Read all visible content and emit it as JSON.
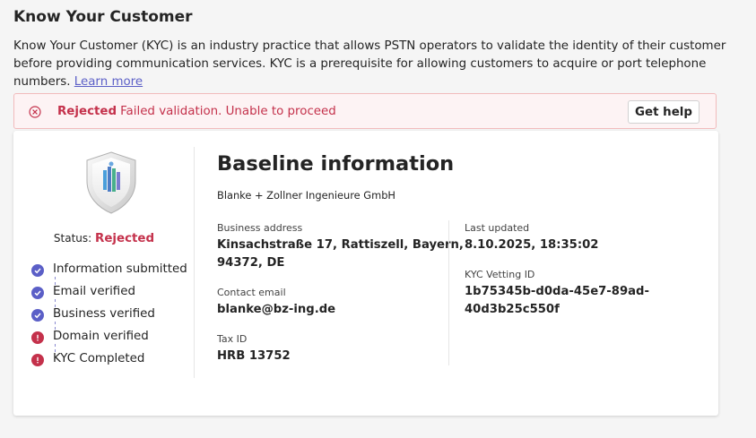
{
  "header": {
    "title": "Know Your Customer",
    "description": "Know Your Customer (KYC) is an industry practice that allows PSTN operators to validate the identity of their customer before providing communication services. KYC is a prerequisite for allowing customers to acquire or port telephone numbers.",
    "learn_more": "Learn more"
  },
  "banner": {
    "status_label": "Rejected",
    "message": "Failed validation. Unable to proceed",
    "help_button": "Get help"
  },
  "status_panel": {
    "status_prefix": "Status:",
    "status_value": "Rejected",
    "steps": [
      {
        "label": "Information submitted",
        "state": "complete"
      },
      {
        "label": "Email verified",
        "state": "complete"
      },
      {
        "label": "Business verified",
        "state": "complete"
      },
      {
        "label": "Domain verified",
        "state": "error"
      },
      {
        "label": "KYC Completed",
        "state": "error"
      }
    ]
  },
  "baseline": {
    "title": "Baseline information",
    "company": "Blanke + Zollner Ingenieure GmbH",
    "address_label": "Business address",
    "address_line1": "Kinsachstraße 17, Rattiszell, Bayern,",
    "address_line2": "94372, DE",
    "email_label": "Contact email",
    "email_value": "blanke@bz-ing.de",
    "tax_label": "Tax ID",
    "tax_value": "HRB 13752",
    "updated_label": "Last updated",
    "updated_value": "8.10.2025, 18:35:02",
    "vetting_label": "KYC Vetting ID",
    "vetting_line1": "1b75345b-d0da-45e7-89ad-",
    "vetting_line2": "40d3b25c550f"
  },
  "colors": {
    "accent": "#5b5fc7",
    "error": "#c4314b",
    "banner_bg": "#fdf3f4"
  }
}
